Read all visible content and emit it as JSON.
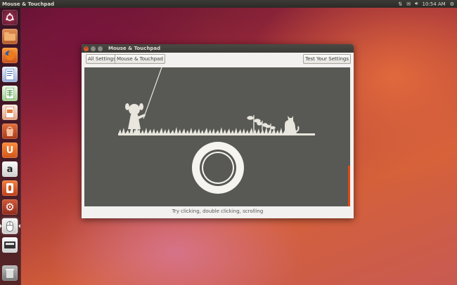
{
  "top_panel": {
    "app_title": "Mouse & Touchpad",
    "clock": "10:54 AM"
  },
  "launcher": {
    "items": [
      {
        "name": "dash"
      },
      {
        "name": "files"
      },
      {
        "name": "firefox"
      },
      {
        "name": "writer"
      },
      {
        "name": "calc"
      },
      {
        "name": "impress"
      },
      {
        "name": "software-center"
      },
      {
        "name": "ubuntu-one"
      },
      {
        "name": "amazon"
      },
      {
        "name": "update-manager"
      },
      {
        "name": "system-settings"
      },
      {
        "name": "mouse-touchpad"
      },
      {
        "name": "removable-drive"
      },
      {
        "name": "trash"
      }
    ]
  },
  "window": {
    "title": "Mouse & Touchpad",
    "all_settings_label": "All Settings",
    "breadcrumb_label": "Mouse & Touchpad",
    "test_settings_label": "Test Your Settings",
    "hint": "Try clicking, double clicking, scrolling"
  },
  "colors": {
    "panel": "#3c3b37",
    "canvas": "#585955",
    "accent_orange": "#dd4814",
    "silhouette": "#e8e6dd"
  }
}
